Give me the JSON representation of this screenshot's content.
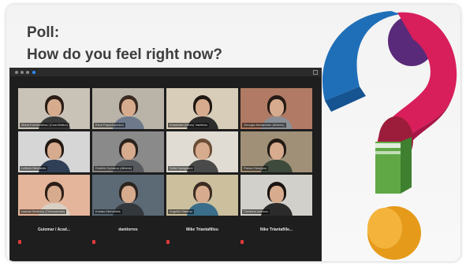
{
  "slide": {
    "title_line1": "Poll:",
    "title_line2": "How do you feel right now?"
  },
  "meeting": {
    "tiles": [
      {
        "label": "Maria Konstantinou (Coordinator)",
        "wall": "#c9c2b6",
        "hair": "#2a1d16",
        "shirt": "#3b3b3b"
      },
      {
        "label": "Eleni Papadopoulou",
        "wall": "#b9b3a8",
        "hair": "#3a2a20",
        "shirt": "#6e7a8c"
      },
      {
        "label": "Anastasia (Nikos) Vasileiou",
        "wall": "#d8cdb9",
        "hair": "#1f1712",
        "shirt": "#2d2d2d"
      },
      {
        "label": "Georgia Alexandrou (Athens)",
        "wall": "#b07a64",
        "hair": "#241a14",
        "shirt": "#8a8f95"
      },
      {
        "label": "Lefteris Nikolaidis",
        "wall": "#d6d6d6",
        "hair": "#221812",
        "shirt": "#2f3f55"
      },
      {
        "label": "Dimitris Kyriakou (Athens)",
        "wall": "#8a8a8a",
        "hair": "#2a211c",
        "shirt": "#565a5e"
      },
      {
        "label": "Sofia Karagianni",
        "wall": "#e0dcd3",
        "hair": "#6b4d35",
        "shirt": "#4a4a4a"
      },
      {
        "label": "Panos Georgiou",
        "wall": "#a09078",
        "hair": "#231a15",
        "shirt": "#3e4a3c"
      },
      {
        "label": "Ioanna Dimitriou (Thessaloniki)",
        "wall": "#e4b59a",
        "hair": "#2b1f17",
        "shirt": "#d9d0c4"
      },
      {
        "label": "Kostas Michailidis",
        "wall": "#5c6a76",
        "hair": "#2c241f",
        "shirt": "#33383d"
      },
      {
        "label": "Angeliki Stavrou",
        "wall": "#cbbf9e",
        "hair": "#3a2c22",
        "shirt": "#3a6e8a"
      },
      {
        "label": "Christina Ioannou",
        "wall": "#d2d0cb",
        "hair": "#1a1411",
        "shirt": "#2b2b2b"
      }
    ],
    "name_tiles": [
      {
        "name": "Guiomar / Acad..."
      },
      {
        "name": "danitorres"
      },
      {
        "name": "Mike Triantafillou"
      },
      {
        "name": "Nike Triantafille..."
      }
    ]
  },
  "graphic": {
    "icon": "question-mark-3d-icon",
    "colors": {
      "blue": "#1f6fb8",
      "purple": "#5a2a7a",
      "magenta": "#d81e5b",
      "maroon": "#9c1c3c",
      "green": "#5fa845",
      "orange": "#e69a1a"
    }
  }
}
